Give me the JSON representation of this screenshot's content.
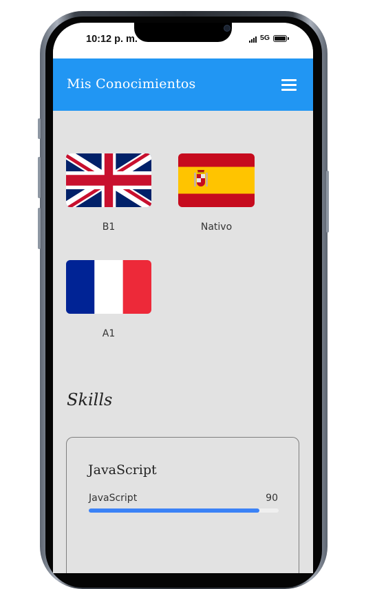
{
  "status_bar": {
    "time": "10:12 p. m.",
    "network": "5G"
  },
  "app_bar": {
    "title": "Mis Conocimientos",
    "menu_icon": "hamburger-menu-icon"
  },
  "languages": [
    {
      "flag": "uk-flag",
      "level": "B1"
    },
    {
      "flag": "spain-flag",
      "level": "Nativo"
    },
    {
      "flag": "france-flag",
      "level": "A1"
    }
  ],
  "skills": {
    "heading": "Skills",
    "cards": [
      {
        "title": "JavaScript",
        "name": "JavaScript",
        "value": "90",
        "progress_percent": 90
      }
    ]
  },
  "colors": {
    "app_bar": "#2196f3",
    "background": "#e2e2e2",
    "progress": "#3b82f6"
  }
}
